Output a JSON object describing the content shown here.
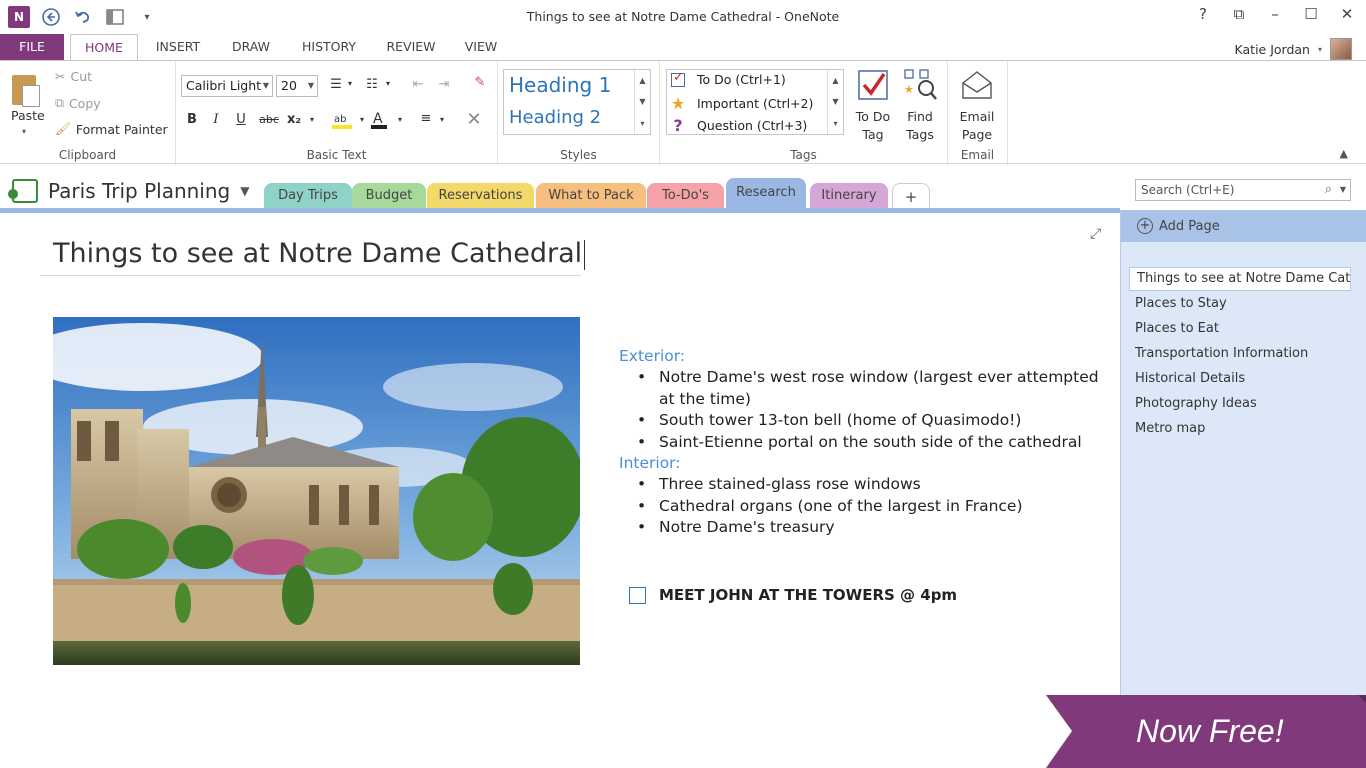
{
  "window": {
    "title": "Things to see at Notre Dame Cathedral - OneNote",
    "app_logo": "N",
    "user_name": "Katie Jordan",
    "controls": [
      "?",
      "⧉",
      "–",
      "☐",
      "✕"
    ]
  },
  "ribbon_tabs": [
    "FILE",
    "HOME",
    "INSERT",
    "DRAW",
    "HISTORY",
    "REVIEW",
    "VIEW"
  ],
  "clipboard": {
    "paste": "Paste",
    "cut": "Cut",
    "copy": "Copy",
    "format_painter": "Format Painter",
    "label": "Clipboard"
  },
  "basic_text": {
    "font_name": "Calibri Light",
    "font_size": "20",
    "label": "Basic Text",
    "bold": "B",
    "italic": "I",
    "underline": "U",
    "strike": "abc",
    "subscript": "x₂"
  },
  "styles": {
    "heading1": "Heading 1",
    "heading2": "Heading 2",
    "label": "Styles"
  },
  "tags": {
    "todo": "To Do (Ctrl+1)",
    "important": "Important (Ctrl+2)",
    "question": "Question (Ctrl+3)",
    "todo_tag_line1": "To Do",
    "todo_tag_line2": "Tag",
    "find_tags_line1": "Find",
    "find_tags_line2": "Tags",
    "label": "Tags"
  },
  "email": {
    "line1": "Email",
    "line2": "Page",
    "label": "Email"
  },
  "notebook": {
    "name": "Paris Trip Planning",
    "sections": [
      {
        "label": "Day Trips",
        "color": "#8fd3c8"
      },
      {
        "label": "Budget",
        "color": "#a6d99a"
      },
      {
        "label": "Reservations",
        "color": "#f3d86a"
      },
      {
        "label": "What to Pack",
        "color": "#f6bf7e"
      },
      {
        "label": "To-Do's",
        "color": "#f5a3a8"
      },
      {
        "label": "Research",
        "color": "#9ab8e3"
      },
      {
        "label": "Itinerary",
        "color": "#d6a6d6"
      }
    ],
    "add_section": "+"
  },
  "search": {
    "placeholder": "Search (Ctrl+E)"
  },
  "page": {
    "title": "Things to see at Notre Dame Cathedral",
    "exterior_heading": "Exterior:",
    "exterior_items": [
      "Notre Dame's west rose window (largest ever attempted at the time)",
      "South tower 13-ton bell (home of Quasimodo!)",
      "Saint-Etienne portal on the south side of the cathedral"
    ],
    "interior_heading": "Interior:",
    "interior_items": [
      "Three stained-glass rose windows",
      "Cathedral organs (one of the largest in France)",
      "Notre Dame's treasury"
    ],
    "todo_item": "MEET JOHN AT THE TOWERS @ 4pm"
  },
  "page_list": {
    "add_page": "Add Page",
    "pages": [
      "Things to see at Notre Dame Cath",
      "Places to Stay",
      "Places to Eat",
      "Transportation Information",
      "Historical Details",
      "Photography Ideas",
      "Metro map"
    ]
  },
  "banner": {
    "text": "Now Free!"
  },
  "colors": {
    "brand": "#80397b",
    "accent_blue": "#2e75b6",
    "pane_blue": "#dce8f7"
  }
}
